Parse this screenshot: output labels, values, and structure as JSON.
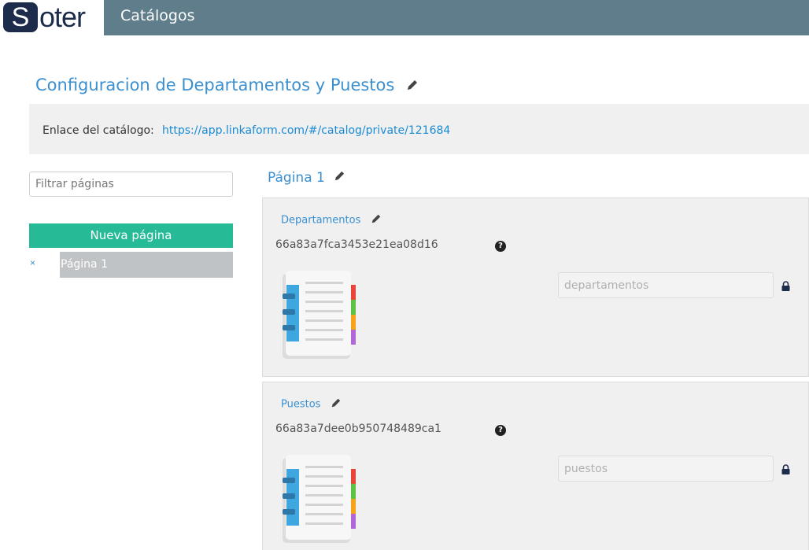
{
  "header": {
    "logo_initial": "S",
    "logo_rest": "oter",
    "nav_title": "Catálogos"
  },
  "page": {
    "title": "Configuracion de Departamentos y Puestos"
  },
  "catalog_link": {
    "label": "Enlace del catálogo:",
    "url": "https://app.linkaform.com/#/catalog/private/121684"
  },
  "sidebar": {
    "filter_placeholder": "Filtrar páginas",
    "new_page_label": "Nueva página",
    "remove_icon": "×",
    "pages": [
      {
        "label": "Página 1"
      }
    ]
  },
  "main": {
    "section_title": "Página 1",
    "cards": [
      {
        "title": "Departamentos",
        "id": "66a83a7fca3453e21ea08d16",
        "help": "?",
        "field_value": "departamentos"
      },
      {
        "title": "Puestos",
        "id": "66a83a7dee0b950748489ca1",
        "help": "?",
        "field_value": "puestos"
      }
    ]
  },
  "colors": {
    "navbar": "#607d8b",
    "accent": "#3a8fd0",
    "new_page_button": "#26bb96",
    "selected_page": "#c0c3c5"
  }
}
